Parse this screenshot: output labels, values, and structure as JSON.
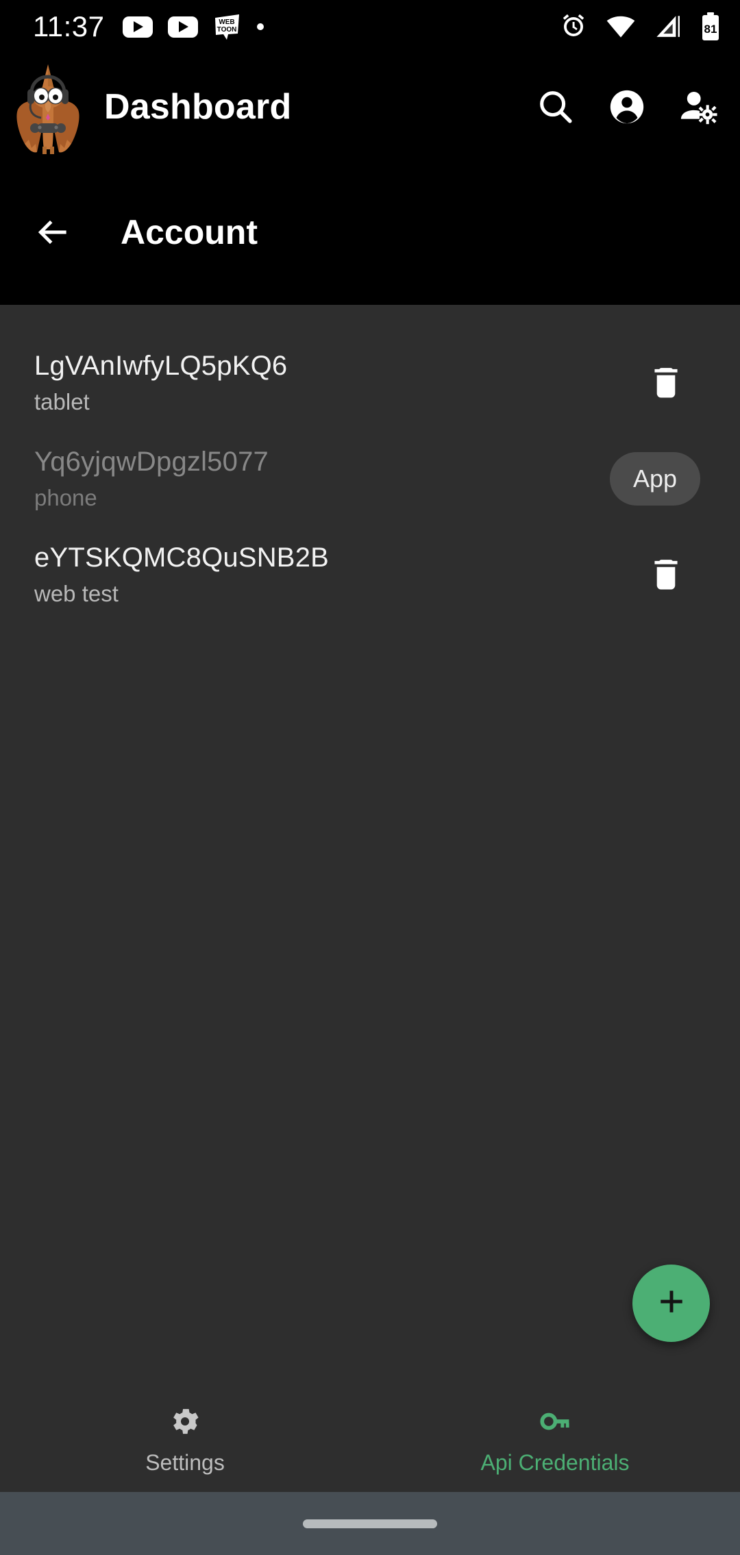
{
  "status_bar": {
    "clock": "11:37",
    "left_icons": [
      "youtube-icon",
      "youtube-icon",
      "webtoon-icon",
      "dot-icon"
    ],
    "right_icons": [
      "alarm-icon",
      "wifi-icon",
      "signal-icon",
      "battery-icon"
    ],
    "battery_level": "81"
  },
  "app_bar": {
    "logo": "pterodactyl-gamer-logo",
    "title": "Dashboard",
    "actions": [
      {
        "name": "search-icon",
        "label": "Search"
      },
      {
        "name": "account-circle-icon",
        "label": "Account"
      },
      {
        "name": "manage-accounts-icon",
        "label": "Manage accounts"
      }
    ]
  },
  "sub_bar": {
    "back_icon": "arrow-back-icon",
    "title": "Account"
  },
  "credentials": [
    {
      "id": "LgVAnIwfyLQ5pKQ6",
      "description": "tablet",
      "action": "delete",
      "action_icon": "trash-icon",
      "disabled": false
    },
    {
      "id": "Yq6yjqwDpgzl5077",
      "description": "phone",
      "action": "chip",
      "chip_label": "App",
      "disabled": true
    },
    {
      "id": "eYTSKQMC8QuSNB2B",
      "description": "web test",
      "action": "delete",
      "action_icon": "trash-icon",
      "disabled": false
    }
  ],
  "fab": {
    "icon": "plus-icon",
    "label": "Add credential"
  },
  "bottom_nav": {
    "items": [
      {
        "label": "Settings",
        "icon": "gear-icon",
        "active": false
      },
      {
        "label": "Api Credentials",
        "icon": "key-icon",
        "active": true
      }
    ]
  },
  "gesture_bar": {
    "handle": "home-handle"
  },
  "colors": {
    "accent_green": "#4caf74",
    "appbar_black": "#000000",
    "surface": "#2e2e2e",
    "chip_bg": "#4b4b4b",
    "gesture_bg": "#474e54"
  }
}
